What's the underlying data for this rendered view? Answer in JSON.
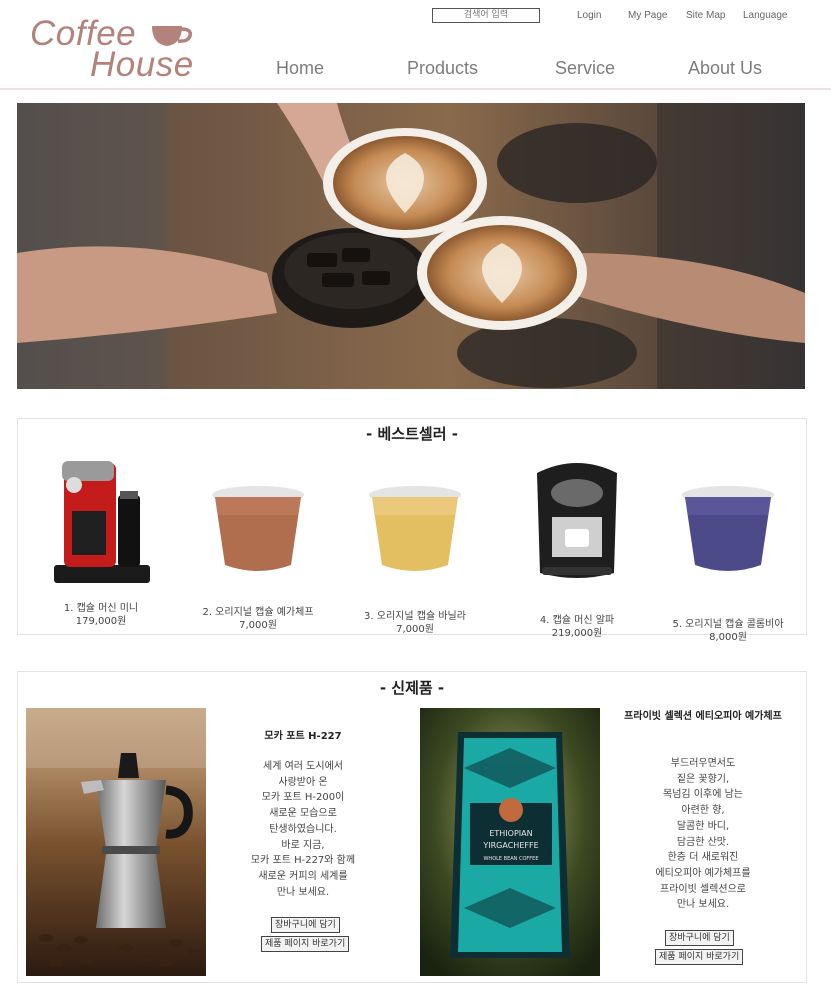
{
  "header": {
    "logo_line1": "Coffee",
    "logo_line2": "House",
    "search_placeholder": "검색어 입력",
    "utility": [
      "Login",
      "My Page",
      "Site Map",
      "Language"
    ],
    "nav": [
      "Home",
      "Products",
      "Service",
      "About Us"
    ]
  },
  "bestseller": {
    "title": "- 베스트셀러 -",
    "items": [
      {
        "name": "1. 캡슐 머신 미니",
        "price": "179,000원"
      },
      {
        "name": "2. 오리지널 캡슐 예가체프",
        "price": "7,000원"
      },
      {
        "name": "3. 오리지널 캡슐 바닐라",
        "price": "7,000원"
      },
      {
        "name": "4. 캡슐 머신 알파",
        "price": "219,000원"
      },
      {
        "name": "5. 오리지널 캡슐 콜롬비아",
        "price": "8,000원"
      }
    ]
  },
  "new_products": {
    "title": "- 신제품 -",
    "products": [
      {
        "title": "모카 포트 H-227",
        "desc": [
          "세계 여러 도시에서",
          "사랑받아 온",
          "모카 포트 H-200이",
          "새로운 모습으로",
          "탄생하였습니다.",
          "바로 지금,",
          "모카 포트 H-227와 함께",
          "새로운 커피의 세계를",
          "만나 보세요."
        ],
        "cart_label": "장바구니에 담기",
        "detail_label": "제품 페이지 바로가기"
      },
      {
        "title": "프라이빗 셀렉션 에티오피아 예가체프",
        "desc": [
          "부드러우면서도",
          "짙은 꽃향기,",
          "목넘김 이후에 남는",
          "아련한 향,",
          "달콤한 바디,",
          "담금한 산맛.",
          "한층 더 새로워진",
          "에티오피아 예가체프를",
          "프라이빗 셀렉션으로",
          "만나 보세요."
        ],
        "cart_label": "장바구니에 담기",
        "detail_label": "제품 페이지 바로가기"
      }
    ]
  },
  "packaging_text": [
    "ETHIOPIAN",
    "YIRGACHEFFE",
    "WHOLE BEAN COFFEE"
  ],
  "colors": {
    "brand": "#b3837b",
    "nav": "#7d7d7d"
  }
}
